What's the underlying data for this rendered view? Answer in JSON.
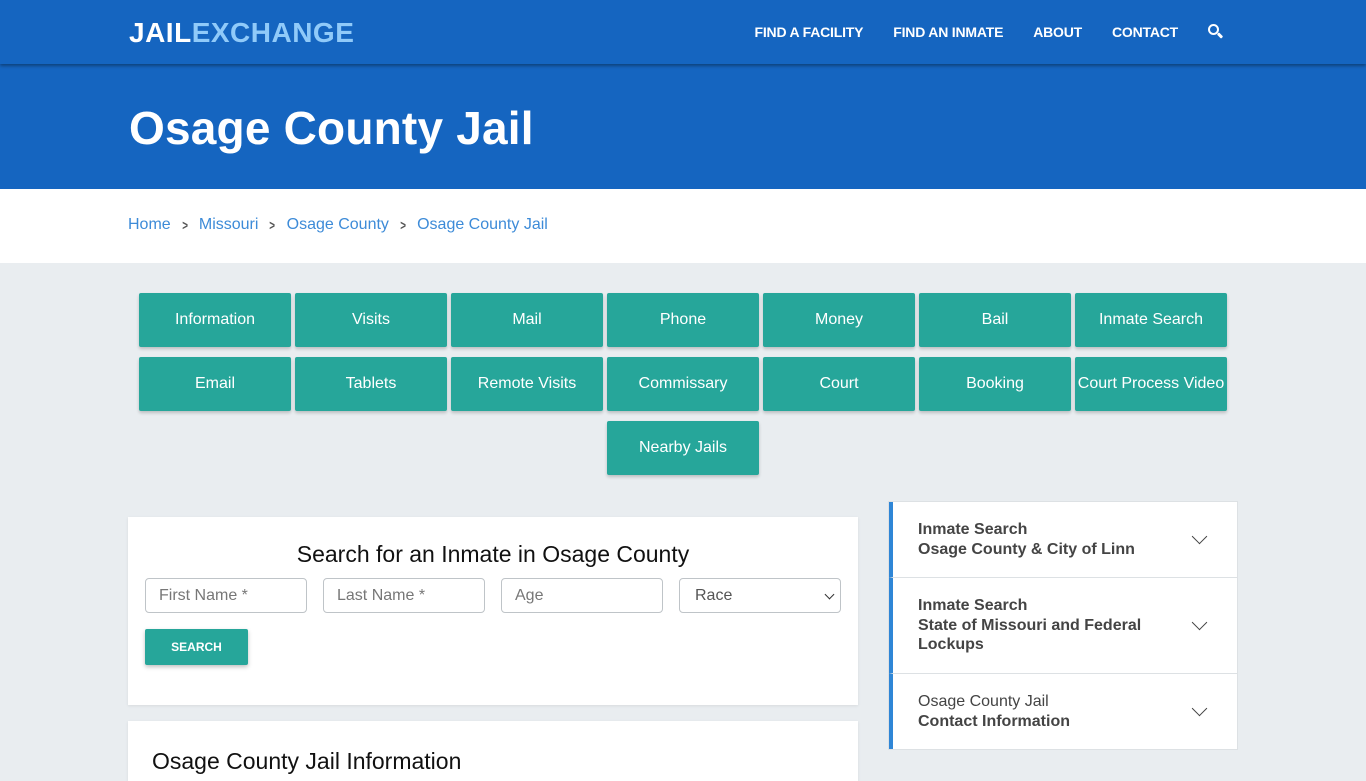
{
  "header": {
    "logo_part1": "JAIL",
    "logo_part2": "EXCHANGE",
    "nav": [
      "FIND A FACILITY",
      "FIND AN INMATE",
      "ABOUT",
      "CONTACT"
    ],
    "search_icon": "search-icon"
  },
  "hero": {
    "title": "Osage County Jail"
  },
  "breadcrumb": [
    "Home",
    "Missouri",
    "Osage County",
    "Osage County Jail"
  ],
  "nav_buttons": [
    "Information",
    "Visits",
    "Mail",
    "Phone",
    "Money",
    "Bail",
    "Inmate Search",
    "Email",
    "Tablets",
    "Remote Visits",
    "Commissary",
    "Court",
    "Booking",
    "Court Process Video",
    "Nearby Jails"
  ],
  "search": {
    "title": "Search for an Inmate in Osage County",
    "first_name_placeholder": "First Name *",
    "last_name_placeholder": "Last Name *",
    "age_placeholder": "Age",
    "race_selected": "Race",
    "button": "SEARCH"
  },
  "info": {
    "title": "Osage County Jail Information"
  },
  "sidebar": [
    {
      "line1": "Inmate Search",
      "line2": "Osage County & City of Linn"
    },
    {
      "line1": "Inmate Search",
      "line2": "State of Missouri and Federal Lockups"
    },
    {
      "line1": "Osage County Jail",
      "line2": "Contact Information"
    }
  ],
  "colors": {
    "brand_blue": "#1565c0",
    "logo_accent": "#90caf9",
    "teal": "#26a69a",
    "link": "#3d8bd8"
  }
}
